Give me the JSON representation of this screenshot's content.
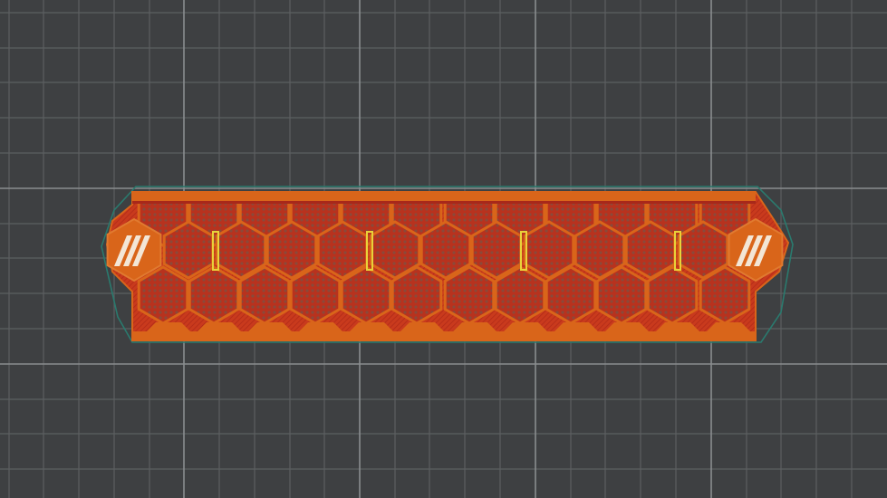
{
  "scene": {
    "background_color": "#3e4042",
    "grid_minor_color": "#5c5f61",
    "grid_major_color": "#8a8d8f",
    "skirt_color": "#2a7a6e",
    "perimeter_color": "#d9651a",
    "infill_color": "#c0301c",
    "support_color": "#e8d23a"
  },
  "part": {
    "layout": "hexagonal-pattern",
    "hex_rows": 3,
    "hex_columns_middle_row": 11,
    "hex_columns_outer_rows": 12,
    "end_caps": [
      "stripe-icon",
      "stripe-icon"
    ]
  }
}
